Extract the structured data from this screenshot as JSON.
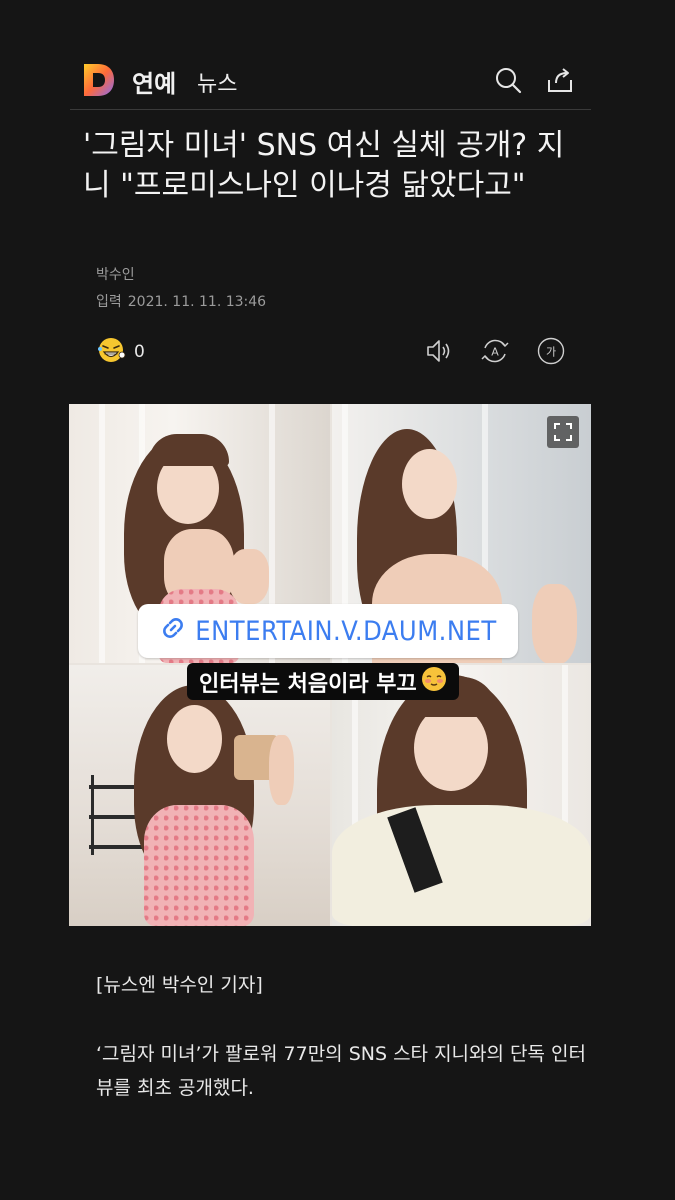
{
  "header": {
    "logo_letter": "D",
    "section": "연예",
    "subsection": "뉴스",
    "icons": [
      "search-icon",
      "share-icon"
    ]
  },
  "article": {
    "title": "'그림자 미녀' SNS 여신 실체 공개? 지니 \"프로미스나인 이나경 닮았다고\"",
    "author": "박수인",
    "timestamp_label": "입력",
    "timestamp": "2021. 11. 11. 13:46",
    "reaction_count": "0",
    "tools": [
      "audio-icon",
      "translate-icon",
      "font-size-icon"
    ],
    "font_size_glyph": "가",
    "translate_glyph": "A"
  },
  "photo": {
    "link_text": "ENTERTAIN.V.DAUM.NET",
    "caption": "인터뷰는 처음이라 부끄"
  },
  "body": {
    "byline": "[뉴스엔 박수인 기자]",
    "paragraph": "‘그림자 미녀’가 팔로워 77만의 SNS 스타 지니와의 단독 인터뷰를 최초 공개했다."
  },
  "colors": {
    "background": "#151515",
    "link_blue": "#3c7df0",
    "text": "#ececec",
    "muted": "#9b9b9b"
  }
}
